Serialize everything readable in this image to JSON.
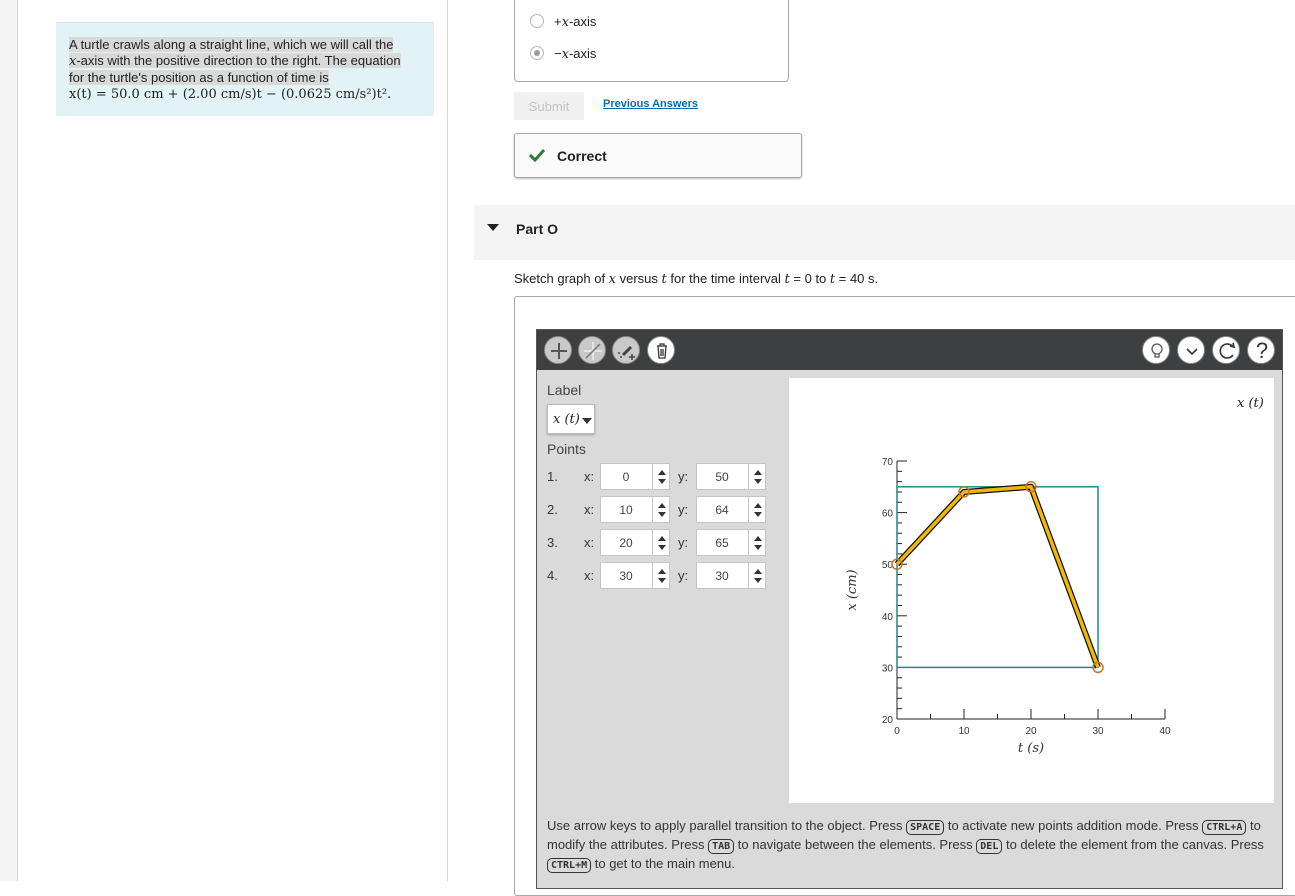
{
  "problem": {
    "line1": "A turtle crawls along a straight line, which we will call the",
    "line2_var": "x",
    "line2_rest": "-axis with the positive direction to the right. The equation",
    "line3": "for the turtle's position as a function of time is",
    "equation": "x(t) = 50.0 cm + (2.00 cm/s)t − (0.0625 cm/s²)t²."
  },
  "prev_part": {
    "choices": [
      {
        "prefix": "+",
        "var": "x",
        "suffix": "-axis",
        "selected": false
      },
      {
        "prefix": "−",
        "var": "x",
        "suffix": "-axis",
        "selected": true
      }
    ],
    "submit_label": "Submit",
    "previous_answers_label": "Previous Answers",
    "correct_label": "Correct",
    "colors": {
      "correct_check": "#2e7d32",
      "link": "#0b6da5"
    }
  },
  "part_o": {
    "title": "Part O",
    "instruction": {
      "a": "Sketch graph of ",
      "x": "x",
      "b": " versus ",
      "t1": "t",
      "c": " for the time interval ",
      "t2": "t",
      "d": " = 0 to ",
      "t3": "t",
      "e": " = 40 s."
    }
  },
  "toolbar": {
    "left_tools": [
      "add-point-icon",
      "add-line-icon",
      "eraser-add-icon",
      "trash-icon"
    ],
    "right_tools": [
      "hint-bulb-icon",
      "chevron-down-icon",
      "reset-icon",
      "help-icon"
    ],
    "help_symbol": "?"
  },
  "panel": {
    "label_heading": "Label",
    "label_value": "x (t)",
    "points_heading": "Points",
    "x_label": "x:",
    "y_label": "y:",
    "points": [
      {
        "n": "1.",
        "x": "0",
        "y": "50"
      },
      {
        "n": "2.",
        "x": "10",
        "y": "64"
      },
      {
        "n": "3.",
        "x": "20",
        "y": "65"
      },
      {
        "n": "4.",
        "x": "30",
        "y": "30"
      }
    ]
  },
  "chart_data": {
    "type": "line",
    "series": [
      {
        "name": "x (t)",
        "x": [
          0,
          10,
          20,
          30
        ],
        "y": [
          50,
          64,
          65,
          30
        ]
      }
    ],
    "xlabel": "t (s)",
    "ylabel": "x (cm)",
    "xlim": [
      0,
      40
    ],
    "ylim": [
      20,
      70
    ],
    "x_ticks": [
      0,
      10,
      20,
      30,
      40
    ],
    "y_ticks": [
      20,
      30,
      40,
      50,
      60,
      70
    ],
    "bounding_box": {
      "x": [
        0,
        30
      ],
      "y": [
        30,
        65
      ]
    },
    "colors": {
      "line": "#f5b800",
      "line_outline": "#111111",
      "points": "#c8742a",
      "box": "#1e8c8c"
    }
  },
  "help": {
    "t1": "Use arrow keys to apply parallel transition to the object. Press ",
    "k1": "SPACE",
    "t2": " to activate new points addition mode. Press ",
    "k2": "CTRL+A",
    "t3": " to modify the attributes. Press ",
    "k3": "TAB",
    "t4": " to navigate between the elements. Press ",
    "k4": "DEL",
    "t5": " to delete the element from the canvas. Press ",
    "k5": "CTRL+M",
    "t6": " to get to the main menu."
  }
}
